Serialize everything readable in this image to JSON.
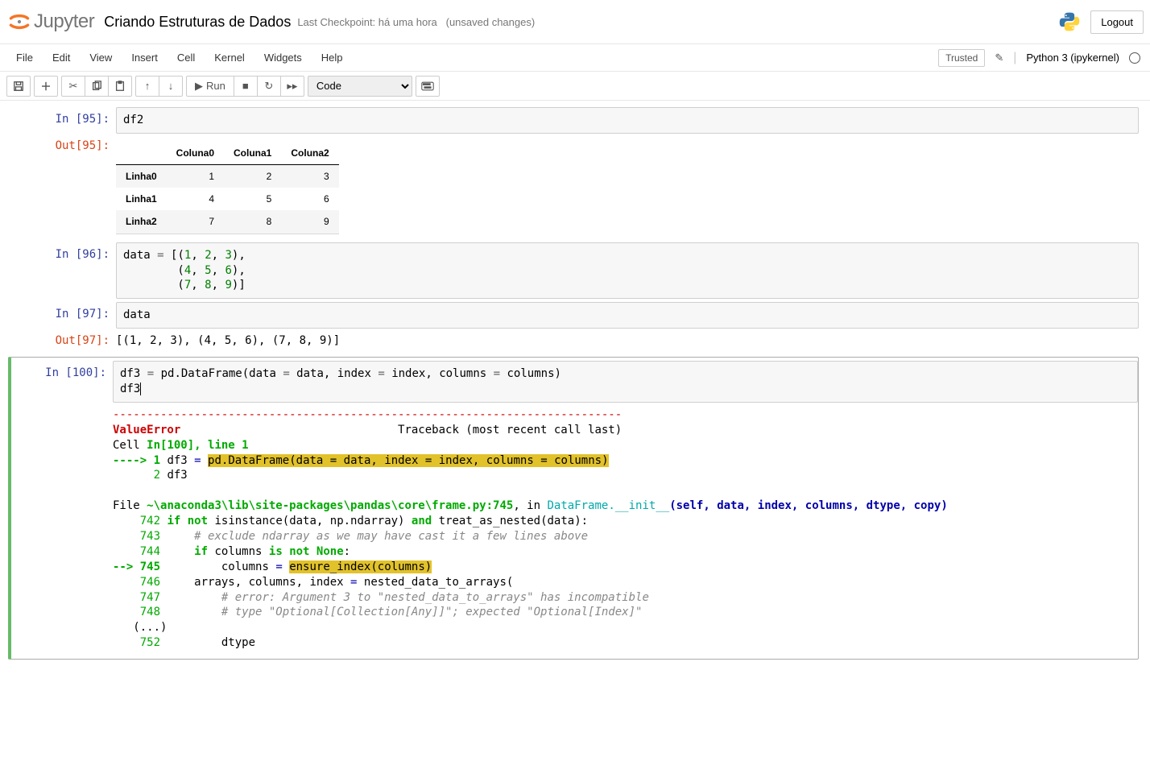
{
  "header": {
    "logo_text": "Jupyter",
    "title": "Criando Estruturas de Dados",
    "checkpoint": "Last Checkpoint: há uma hora",
    "unsaved": "(unsaved changes)",
    "logout": "Logout"
  },
  "menu": {
    "file": "File",
    "edit": "Edit",
    "view": "View",
    "insert": "Insert",
    "cell": "Cell",
    "kernel": "Kernel",
    "widgets": "Widgets",
    "help": "Help",
    "trusted": "Trusted",
    "kernel_name": "Python 3 (ipykernel)"
  },
  "toolbar": {
    "run": "Run",
    "celltype_selected": "Code"
  },
  "cells": [
    {
      "in_label": "In [95]:",
      "code_html": "df2",
      "out_label": "Out[95]:",
      "table": {
        "columns": [
          "Coluna0",
          "Coluna1",
          "Coluna2"
        ],
        "index": [
          "Linha0",
          "Linha1",
          "Linha2"
        ],
        "data": [
          [
            1,
            2,
            3
          ],
          [
            4,
            5,
            6
          ],
          [
            7,
            8,
            9
          ]
        ]
      }
    },
    {
      "in_label": "In [96]:",
      "code_html": "data <span class=\"c-o\">=</span> [(<span class=\"c-m\">1</span>, <span class=\"c-m\">2</span>, <span class=\"c-m\">3</span>),\n        (<span class=\"c-m\">4</span>, <span class=\"c-m\">5</span>, <span class=\"c-m\">6</span>),\n        (<span class=\"c-m\">7</span>, <span class=\"c-m\">8</span>, <span class=\"c-m\">9</span>)]"
    },
    {
      "in_label": "In [97]:",
      "code_html": "data",
      "out_label": "Out[97]:",
      "out_text": "[(1, 2, 3), (4, 5, 6), (7, 8, 9)]"
    },
    {
      "in_label": "In [100]:",
      "code_html": "df3 <span class=\"c-o\">=</span> pd.DataFrame(data <span class=\"c-o\">=</span> data, index <span class=\"c-o\">=</span> index, columns <span class=\"c-o\">=</span> columns)\ndf3<span class=\"cursor\"></span>",
      "traceback_html": "<span class=\"ansi-red-dash\">---------------------------------------------------------------------------</span>\n<span class=\"ansi-red-b\">ValueError</span>                                Traceback (most recent call last)\nCell <span class=\"ansi-green-b\">In[100], line 1</span>\n<span class=\"ansi-green-b\">----&gt; 1</span> df3 <span class=\"ansi-blue\">=</span> <span class=\"ansi-yellow-bg\">pd</span><span class=\"ansi-yellow-bg\">.</span><span class=\"ansi-yellow-bg\">DataFrame</span><span class=\"ansi-yellow-bg\">(</span><span class=\"ansi-yellow-bg\">data</span><span class=\"ansi-yellow-bg\"> </span><span class=\"ansi-yellow-bg\">=</span><span class=\"ansi-yellow-bg\"> </span><span class=\"ansi-yellow-bg\">data</span><span class=\"ansi-yellow-bg\">,</span><span class=\"ansi-yellow-bg\"> </span><span class=\"ansi-yellow-bg\">index</span><span class=\"ansi-yellow-bg\"> </span><span class=\"ansi-yellow-bg\">=</span><span class=\"ansi-yellow-bg\"> </span><span class=\"ansi-yellow-bg\">index</span><span class=\"ansi-yellow-bg\">,</span><span class=\"ansi-yellow-bg\"> </span><span class=\"ansi-yellow-bg\">columns</span><span class=\"ansi-yellow-bg\"> </span><span class=\"ansi-yellow-bg\">=</span><span class=\"ansi-yellow-bg\"> </span><span class=\"ansi-yellow-bg\">columns</span><span class=\"ansi-yellow-bg\">)</span>\n      <span class=\"ansi-green\">2</span> df3\n\nFile <span class=\"ansi-green-b\">~\\anaconda3\\lib\\site-packages\\pandas\\core\\frame.py:745</span>, in <span class=\"ansi-cyan\">DataFrame.__init__</span><span class=\"ansi-blue-b\">(self, data, index, columns, dtype, copy)</span>\n    <span class=\"ansi-green\">742</span> <span class=\"ansi-green-b\">if</span> <span class=\"ansi-green-b\">not</span> isinstance(data, np.ndarray) <span class=\"ansi-green-b\">and</span> treat_as_nested(data):\n    <span class=\"ansi-green\">743</span>     <span class=\"ansi-grey-i\"># exclude ndarray as we may have cast it a few lines above</span>\n    <span class=\"ansi-green\">744</span>     <span class=\"ansi-green-b\">if</span> columns <span class=\"ansi-green-b\">is</span> <span class=\"ansi-green-b\">not</span> <span class=\"ansi-green-b\">None</span>:\n<span class=\"ansi-green-b\">--&gt; 745</span>         columns <span class=\"ansi-blue\">=</span> <span class=\"ansi-yellow-bg\">ensure_index</span><span class=\"ansi-yellow-bg\">(</span><span class=\"ansi-yellow-bg\">columns</span><span class=\"ansi-yellow-bg\">)</span>\n    <span class=\"ansi-green\">746</span>     arrays, columns, index <span class=\"ansi-blue\">=</span> nested_data_to_arrays(\n    <span class=\"ansi-green\">747</span>         <span class=\"ansi-grey-i\"># error: Argument 3 to \"nested_data_to_arrays\" has incompatible</span>\n    <span class=\"ansi-green\">748</span>         <span class=\"ansi-grey-i\"># type \"Optional[Collection[Any]]\"; expected \"Optional[Index]\"</span>\n   (...)\n    <span class=\"ansi-green\">752</span>         dtype"
    }
  ]
}
